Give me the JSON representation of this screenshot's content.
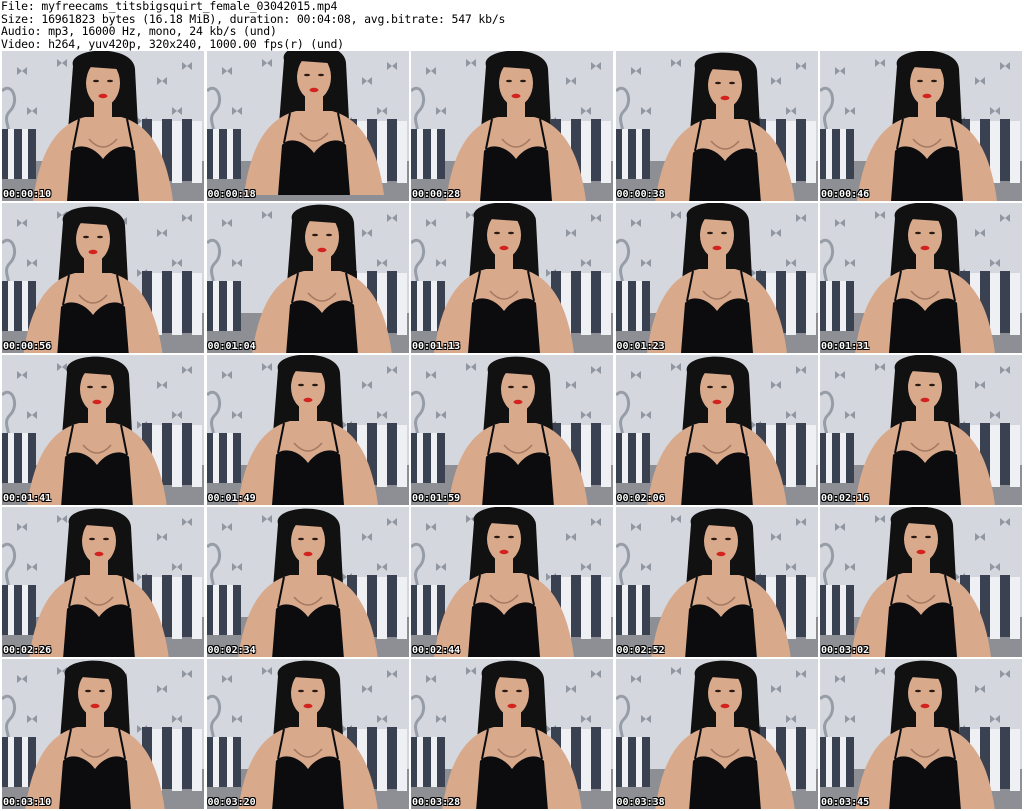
{
  "header": {
    "file_line": "File: myfreecams_titsbigsquirt_female_03042015.mp4",
    "size_line": "Size: 16961823 bytes (16.18 MiB), duration: 00:04:08, avg.bitrate: 547 kb/s",
    "audio_line": "Audio: mp3, 16000 Hz, mono, 24 kb/s (und)",
    "video_line": "Video: h264, yuv420p, 320x240, 1000.00 fps(r) (und)"
  },
  "thumbnails": [
    {
      "timestamp": "00:00:10"
    },
    {
      "timestamp": "00:00:18"
    },
    {
      "timestamp": "00:00:28"
    },
    {
      "timestamp": "00:00:38"
    },
    {
      "timestamp": "00:00:46"
    },
    {
      "timestamp": "00:00:56"
    },
    {
      "timestamp": "00:01:04"
    },
    {
      "timestamp": "00:01:13"
    },
    {
      "timestamp": "00:01:23"
    },
    {
      "timestamp": "00:01:31"
    },
    {
      "timestamp": "00:01:41"
    },
    {
      "timestamp": "00:01:49"
    },
    {
      "timestamp": "00:01:59"
    },
    {
      "timestamp": "00:02:06"
    },
    {
      "timestamp": "00:02:16"
    },
    {
      "timestamp": "00:02:26"
    },
    {
      "timestamp": "00:02:34"
    },
    {
      "timestamp": "00:02:44"
    },
    {
      "timestamp": "00:02:52"
    },
    {
      "timestamp": "00:03:02"
    },
    {
      "timestamp": "00:03:10"
    },
    {
      "timestamp": "00:03:20"
    },
    {
      "timestamp": "00:03:28"
    },
    {
      "timestamp": "00:03:38"
    },
    {
      "timestamp": "00:03:45"
    }
  ],
  "colors": {
    "wall": "#d4d8de",
    "wall_pattern": "#5a6270",
    "hair": "#111111",
    "skin": "#d9a98c",
    "top": "#0c0c0e",
    "stripe_dark": "#3a4150",
    "stripe_light": "#eef0f3",
    "bed": "#8d8f94",
    "lips": "#d2231f"
  }
}
